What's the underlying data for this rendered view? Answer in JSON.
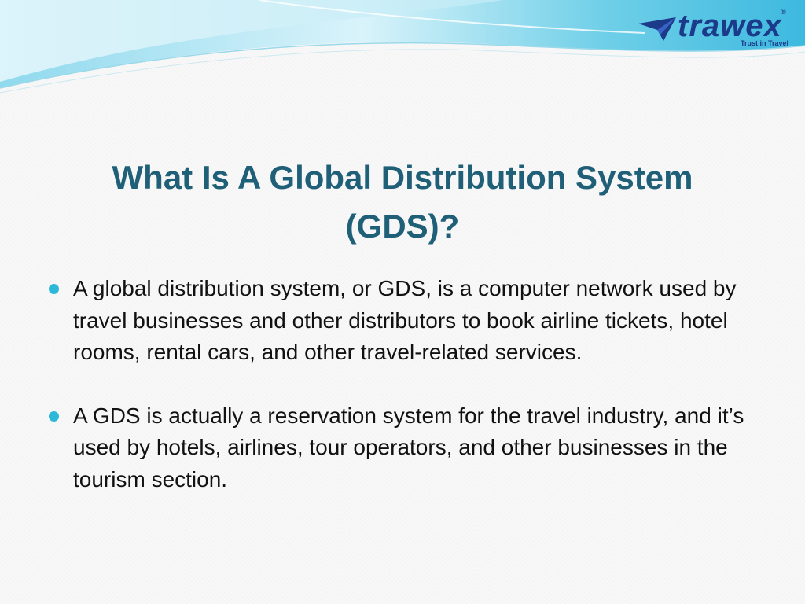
{
  "header": {
    "logo": {
      "mark_icon": "arrow-plane-icon",
      "wordmark": "trawex",
      "registered": "®",
      "tagline": "Trust in Travel"
    }
  },
  "slide": {
    "title": "What Is A Global Distribution System (GDS)?",
    "bullets": [
      "A global distribution system, or GDS, is a computer network used by travel businesses and other distributors to book airline tickets, hotel rooms, rental cars, and other travel-related services.",
      "A GDS is actually a reservation system for the travel industry, and it’s used by hotels, airlines, tour operators, and other businesses in the tourism section."
    ]
  },
  "colors": {
    "title": "#1f5f77",
    "bullet_marker": "#2eb8d8",
    "wave_light": "#bfe9f5",
    "wave_mid": "#5cc6e3",
    "logo": "#1b3a8a"
  }
}
